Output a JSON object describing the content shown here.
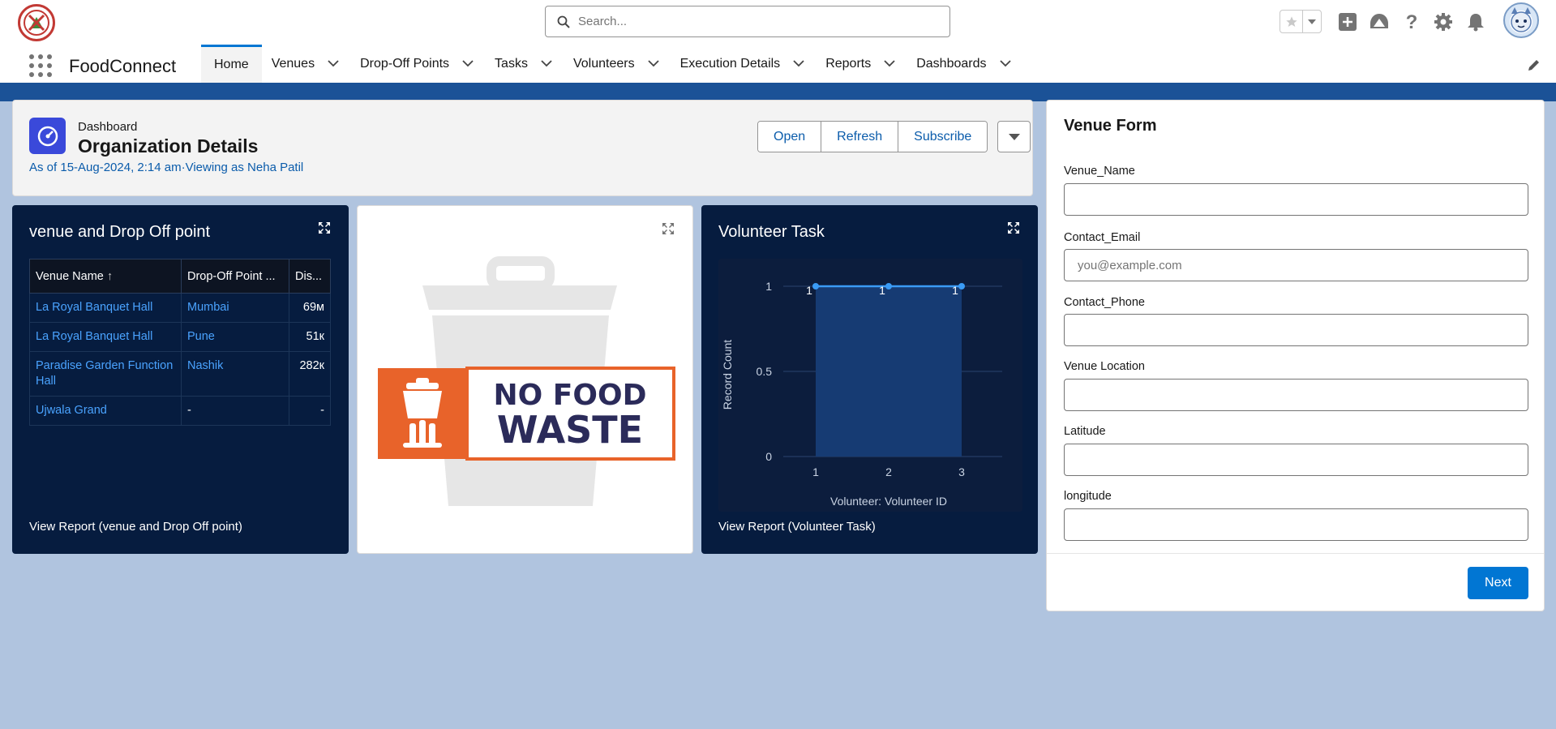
{
  "app": {
    "name": "FoodConnect",
    "search_placeholder": "Search..."
  },
  "nav": {
    "items": [
      {
        "label": "Home",
        "active": true,
        "has_menu": false
      },
      {
        "label": "Venues",
        "has_menu": true
      },
      {
        "label": "Drop-Off Points",
        "has_menu": true
      },
      {
        "label": "Tasks",
        "has_menu": true
      },
      {
        "label": "Volunteers",
        "has_menu": true
      },
      {
        "label": "Execution Details",
        "has_menu": true
      },
      {
        "label": "Reports",
        "has_menu": true
      },
      {
        "label": "Dashboards",
        "has_menu": true
      }
    ]
  },
  "dashboard": {
    "kicker": "Dashboard",
    "title": "Organization Details",
    "meta": "As of 15-Aug-2024, 2:14 am·Viewing as Neha Patil",
    "buttons": {
      "open": "Open",
      "refresh": "Refresh",
      "subscribe": "Subscribe"
    }
  },
  "venue_widget": {
    "title": "venue and Drop Off point",
    "columns": [
      "Venue Name",
      "Drop-Off Point ...",
      "Dis..."
    ],
    "sort_indicator": "↑",
    "rows": [
      {
        "venue": "La Royal Banquet Hall",
        "dropoff": "Mumbai",
        "dist": "69м"
      },
      {
        "venue": "La Royal Banquet Hall",
        "dropoff": "Pune",
        "dist": "51к"
      },
      {
        "venue": "Paradise Garden Function Hall",
        "dropoff": "Nashik",
        "dist": "282к"
      },
      {
        "venue": "Ujwala Grand",
        "dropoff": "-",
        "dist": "-"
      }
    ],
    "footer": "View Report (venue and Drop Off point)"
  },
  "image_widget": {
    "line1": "NO FOOD",
    "line2": "WASTE"
  },
  "volunteer_widget": {
    "title": "Volunteer Task",
    "footer": "View Report (Volunteer Task)"
  },
  "chart_data": {
    "type": "area",
    "title": "Volunteer Task",
    "xlabel": "Volunteer: Volunteer ID",
    "ylabel": "Record Count",
    "categories": [
      "1",
      "2",
      "3"
    ],
    "values": [
      1,
      1,
      1
    ],
    "data_labels": [
      "1",
      "1",
      "1"
    ],
    "yticks": [
      "0",
      "0.5",
      "1"
    ],
    "ylim": [
      0,
      1
    ],
    "grid": true,
    "line_color": "#3a9bf5",
    "fill_color": "#163b73"
  },
  "venue_form": {
    "title": "Venue Form",
    "fields": [
      {
        "label": "Venue_Name",
        "value": "",
        "placeholder": ""
      },
      {
        "label": "Contact_Email",
        "value": "",
        "placeholder": "you@example.com"
      },
      {
        "label": "Contact_Phone",
        "value": "",
        "placeholder": ""
      },
      {
        "label": "Venue Location",
        "value": "",
        "placeholder": ""
      },
      {
        "label": "Latitude",
        "value": "",
        "placeholder": ""
      },
      {
        "label": "longitude",
        "value": "",
        "placeholder": ""
      }
    ],
    "next_label": "Next"
  },
  "colors": {
    "brand_blue": "#0176d3",
    "link_blue": "#0b5cab",
    "dark_widget": "#061c3f",
    "banner": "#1b5297",
    "background": "#b0c4df",
    "orange": "#e8632a",
    "navy_text": "#2b2b5a"
  },
  "icons": [
    "search-icon",
    "star-icon",
    "chevron-down-icon",
    "add-icon",
    "trailhead-icon",
    "help-icon",
    "gear-icon",
    "bell-icon",
    "app-launcher-icon",
    "pencil-icon",
    "dashboard-icon",
    "expand-icon",
    "trash-bin-icon"
  ]
}
